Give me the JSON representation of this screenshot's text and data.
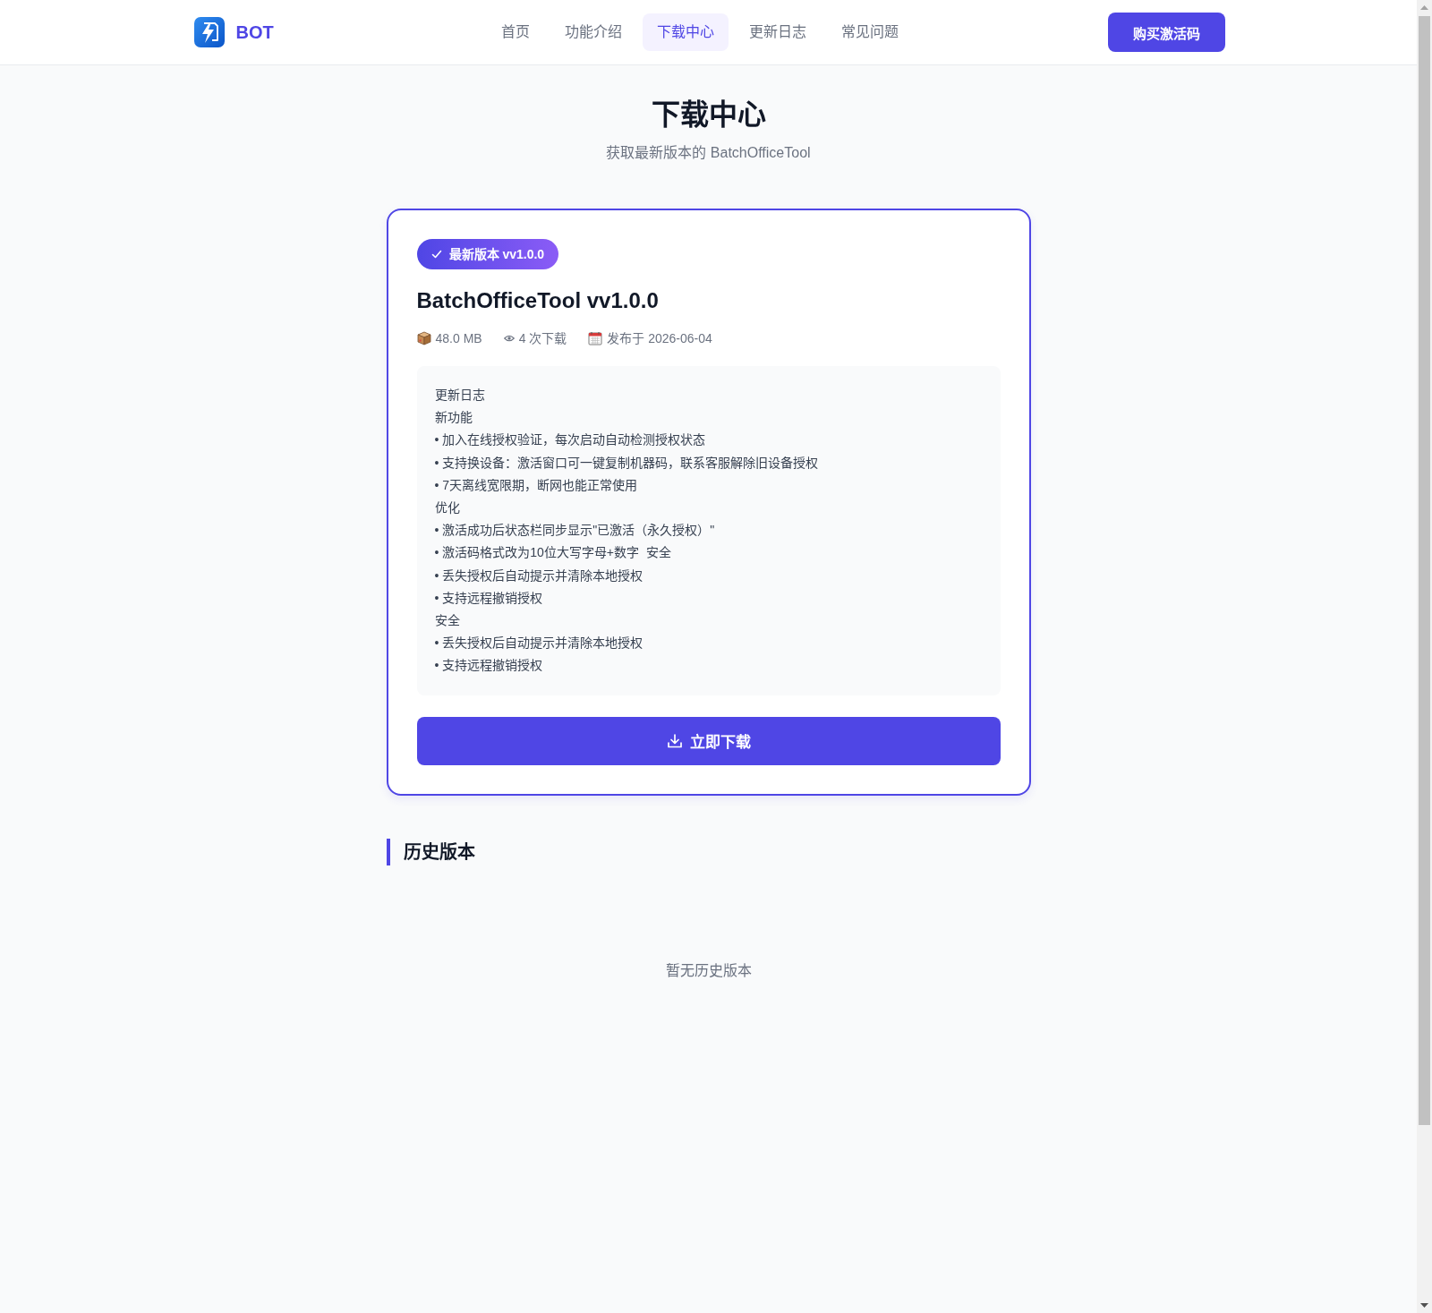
{
  "header": {
    "logo_text": "BOT",
    "nav": [
      {
        "label": "首页",
        "selected": false
      },
      {
        "label": "功能介绍",
        "selected": false
      },
      {
        "label": "下载中心",
        "selected": true
      },
      {
        "label": "更新日志",
        "selected": false
      },
      {
        "label": "常见问题",
        "selected": false
      }
    ],
    "cta": "购买激活码"
  },
  "page": {
    "title": "下载中心",
    "subtitle": "获取最新版本的 BatchOfficeTool"
  },
  "latest": {
    "badge": "最新版本 vv1.0.0",
    "title": "BatchOfficeTool vv1.0.0",
    "meta": [
      {
        "kind": "size",
        "text": "48.0 MB"
      },
      {
        "kind": "downloads",
        "text": "4 次下载"
      },
      {
        "kind": "date",
        "text": "发布于 2026-06-04"
      }
    ],
    "changelog": [
      "更新日志",
      "新功能",
      "• 加入在线授权验证，每次启动自动检测授权状态",
      "• 支持换设备：激活窗口可一键复制机器码，联系客服解除旧设备授权",
      "• 7天离线宽限期，断网也能正常使用",
      "优化",
      "• 激活成功后状态栏同步显示\"已激活（永久授权）\"",
      "• 激活码格式改为10位大写字母+数字  安全",
      "• 丢失授权后自动提示并清除本地授权",
      "• 支持远程撤销授权",
      "安全",
      "• 丢失授权后自动提示并清除本地授权",
      "• 支持远程撤销授权"
    ],
    "download_button": "立即下载"
  },
  "history": {
    "title": "历史版本",
    "empty_text": "暂无历史版本"
  }
}
